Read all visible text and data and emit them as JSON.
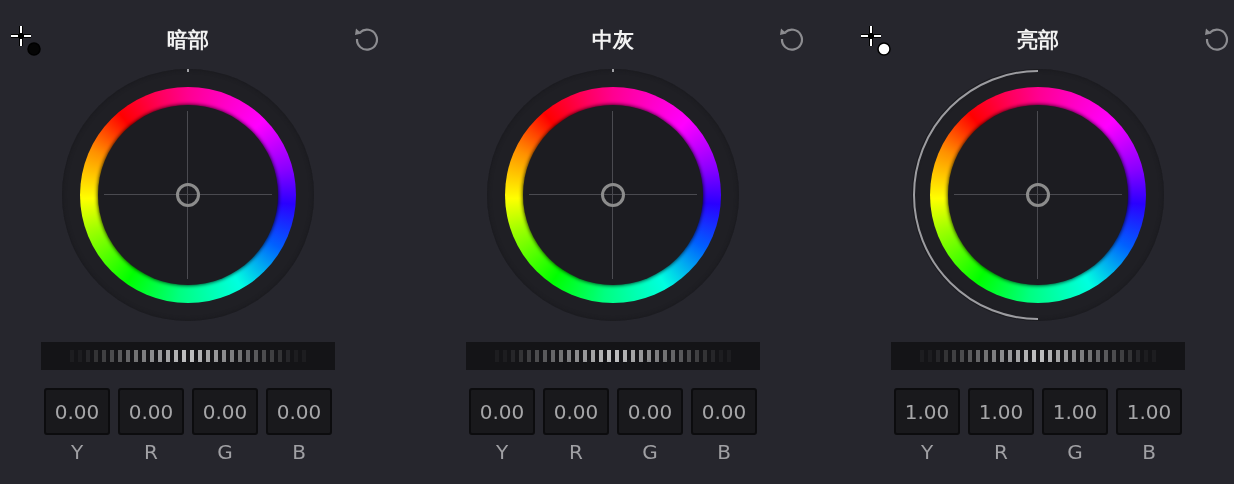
{
  "panels": [
    {
      "title": "暗部",
      "picker": {
        "light": false
      },
      "ring_arc": false,
      "values": [
        {
          "value": "0.00",
          "label": "Y"
        },
        {
          "value": "0.00",
          "label": "R"
        },
        {
          "value": "0.00",
          "label": "G"
        },
        {
          "value": "0.00",
          "label": "B"
        }
      ]
    },
    {
      "title": "中灰",
      "ring_arc": false,
      "values": [
        {
          "value": "0.00",
          "label": "Y"
        },
        {
          "value": "0.00",
          "label": "R"
        },
        {
          "value": "0.00",
          "label": "G"
        },
        {
          "value": "0.00",
          "label": "B"
        }
      ]
    },
    {
      "title": "亮部",
      "picker": {
        "light": true
      },
      "ring_arc": true,
      "values": [
        {
          "value": "1.00",
          "label": "Y"
        },
        {
          "value": "1.00",
          "label": "R"
        },
        {
          "value": "1.00",
          "label": "G"
        },
        {
          "value": "1.00",
          "label": "B"
        }
      ]
    }
  ]
}
